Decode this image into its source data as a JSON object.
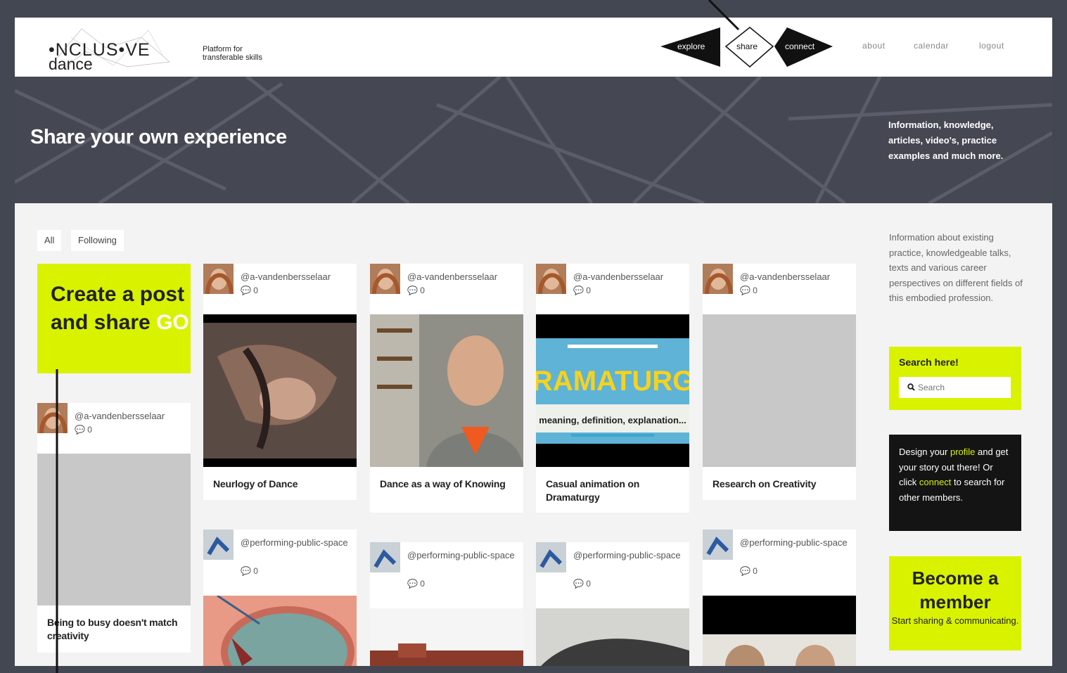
{
  "logo": {
    "line1": "•NCLUS•VE",
    "line2": "dance",
    "tagline_1": "Platform for",
    "tagline_2": "transferable skills"
  },
  "nav": {
    "explore": "explore",
    "share": "share",
    "connect": "connect",
    "about": "about",
    "calendar": "calendar",
    "logout": "logout"
  },
  "hero": {
    "title": "Share your own experience",
    "side": "Information, knowledge, articles, video's, practice examples and much more."
  },
  "filters": {
    "all": "All",
    "following": "Following"
  },
  "create": {
    "text": "Create a post and share",
    "go": "GO"
  },
  "cards_row1": [
    {
      "user": "@a-vandenbersselaar",
      "comments": "0",
      "title": "Neurlogy of Dance"
    },
    {
      "user": "@a-vandenbersselaar",
      "comments": "0",
      "title": "Dance as a way of Knowing"
    },
    {
      "user": "@a-vandenbersselaar",
      "comments": "0",
      "title": "Casual animation on Dramaturgy"
    },
    {
      "user": "@a-vandenbersselaar",
      "comments": "0",
      "title": "Research on Creativity"
    }
  ],
  "card_left": {
    "user": "@a-vandenbersselaar",
    "comments": "0",
    "title": "Being to busy doesn't match creativity"
  },
  "cards_row2": [
    {
      "user": "@performing-public-space",
      "comments": "0"
    },
    {
      "user": "@performing-public-space",
      "comments": "0"
    },
    {
      "user": "@performing-public-space",
      "comments": "0"
    },
    {
      "user": "@performing-public-space",
      "comments": "0"
    }
  ],
  "dramaturgy_thumb": {
    "word": "DRAMATURGY",
    "sub": "meaning, definition, explanation..."
  },
  "sidebar": {
    "intro": "Information about existing practice, knowledgeable talks, texts and various career perspectives on different fields of this embodied profession.",
    "search_label": "Search here!",
    "search_placeholder": "Search",
    "design_1": "Design your ",
    "design_profile": "profile",
    "design_2": " and get your story out there! Or click ",
    "design_connect": "connect",
    "design_3": " to search for other members.",
    "member_big": "Become a member",
    "member_small": "Start sharing & communicating."
  },
  "colors": {
    "accent": "#d9f200",
    "hero": "#454853",
    "frame": "#434751"
  }
}
